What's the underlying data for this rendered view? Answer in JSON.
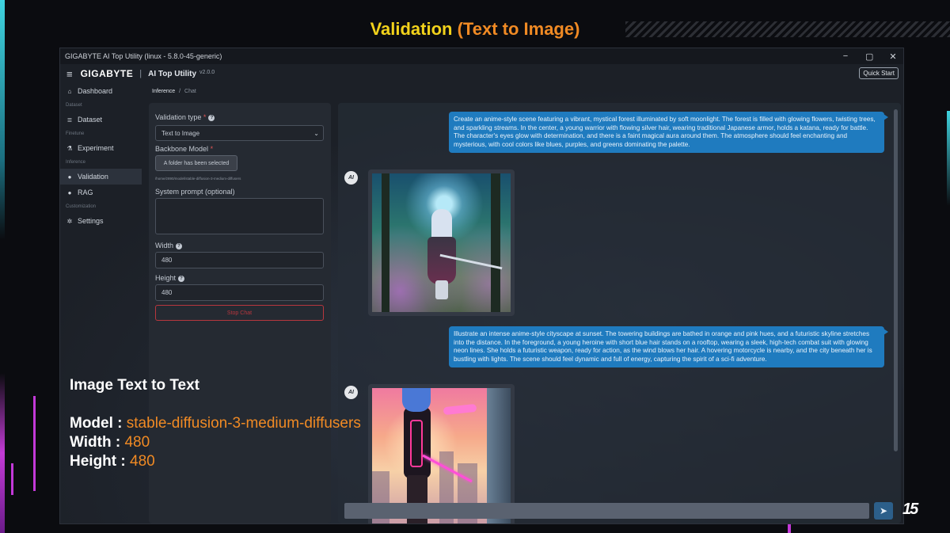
{
  "slide": {
    "title_main": "Validation",
    "title_sub": "(Text to Image)",
    "logo": "15"
  },
  "window": {
    "title": "GIGABYTE AI Top Utility (linux - 5.8.0-45-generic)",
    "controls": {
      "minimize": "−",
      "maximize": "▢",
      "close": "✕"
    }
  },
  "header": {
    "brand": "GIGABYTE",
    "app_name": "AI Top Utility",
    "version": "v2.0.0",
    "quick_start": "Quick Start"
  },
  "sidebar": {
    "items": [
      {
        "type": "item",
        "label": "Dashboard",
        "icon": "home-icon",
        "active": false
      },
      {
        "type": "section",
        "label": "Dataset"
      },
      {
        "type": "item",
        "label": "Dataset",
        "icon": "database-icon",
        "active": false
      },
      {
        "type": "section",
        "label": "Finetune"
      },
      {
        "type": "item",
        "label": "Experiment",
        "icon": "flask-icon",
        "active": false
      },
      {
        "type": "section",
        "label": "Inference"
      },
      {
        "type": "item",
        "label": "Validation",
        "icon": "chat-icon",
        "active": true
      },
      {
        "type": "item",
        "label": "RAG",
        "icon": "chat-icon",
        "active": false
      },
      {
        "type": "section",
        "label": "Customization"
      },
      {
        "type": "item",
        "label": "Settings",
        "icon": "gear-icon",
        "active": false
      }
    ]
  },
  "breadcrumb": {
    "parent": "Inference",
    "separator": "/",
    "current": "Chat"
  },
  "form": {
    "validation_type_label": "Validation type",
    "validation_type_value": "Text to Image",
    "backbone_label": "Backbone Model",
    "folder_button": "A folder has been selected",
    "model_path": "/home/z890/model/stable-diffusion-3-medium-diffusers",
    "system_prompt_label": "System prompt (optional)",
    "system_prompt_value": "",
    "width_label": "Width",
    "width_value": "480",
    "height_label": "Height",
    "height_value": "480",
    "stop_button": "Stop Chat"
  },
  "chat": {
    "prompt1": "Create an anime-style scene featuring a vibrant, mystical forest illuminated by soft moonlight. The forest is filled with glowing flowers, twisting trees, and sparkling streams. In the center, a young warrior with flowing silver hair, wearing traditional Japanese armor, holds a katana, ready for battle. The character's eyes glow with determination, and there is a faint magical aura around them. The atmosphere should feel enchanting and mysterious, with cool colors like blues, purples, and greens dominating the palette.",
    "prompt2": "Illustrate an intense anime-style cityscape at sunset. The towering buildings are bathed in orange and pink hues, and a futuristic skyline stretches into the distance. In the foreground, a young heroine with short blue hair stands on a rooftop, wearing a sleek, high-tech combat suit with glowing neon lines. She holds a futuristic weapon, ready for action, as the wind blows her hair. A hovering motorcycle is nearby, and the city beneath her is bustling with lights. The scene should feel dynamic and full of energy, capturing the spirit of a sci-fi adventure.",
    "avatar_label": "AI",
    "input_value": "",
    "send_icon": "send-icon"
  },
  "overlay": {
    "heading": "Image Text to Text",
    "model_label": "Model : ",
    "model_value": "stable-diffusion-3-medium-diffusers",
    "width_label": "Width : ",
    "width_value": "480",
    "height_label": "Height : ",
    "height_value": "480"
  },
  "colors": {
    "accent_blue": "#1f7bbf",
    "title_yellow": "#f2d21b",
    "highlight_orange": "#f08a24",
    "danger_red": "#b8373e"
  }
}
